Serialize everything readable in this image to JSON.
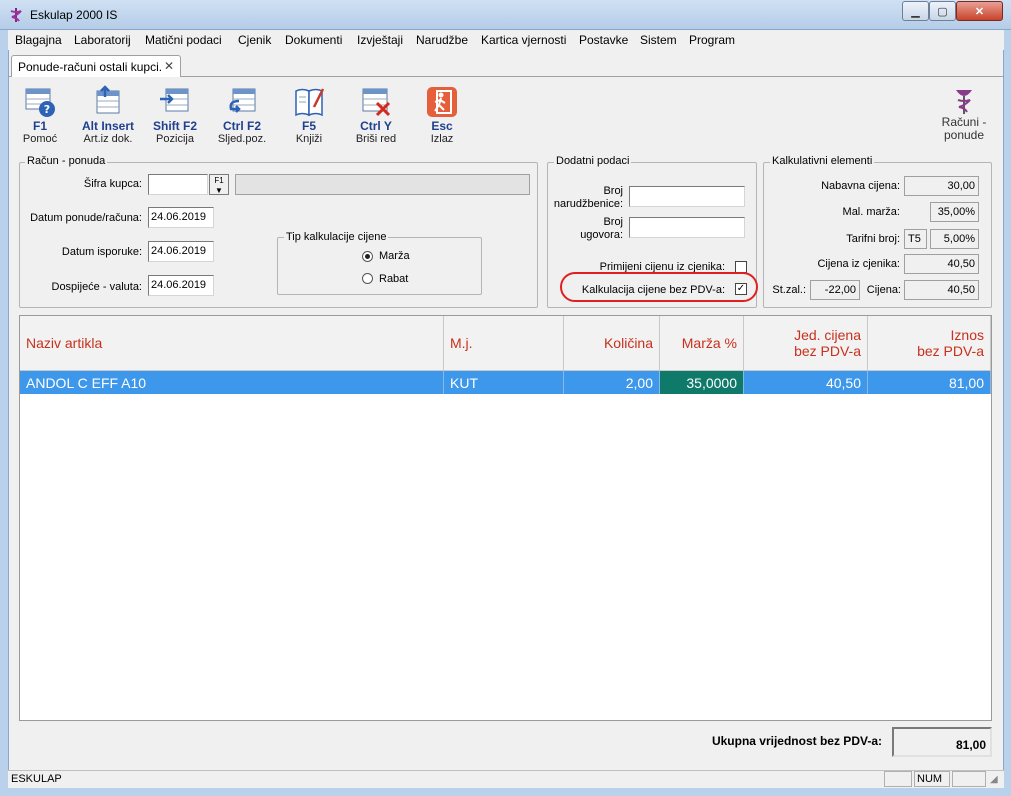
{
  "window": {
    "title": "Eskulap 2000  IS"
  },
  "menu": [
    {
      "label": "Blagajna"
    },
    {
      "label": "Laboratorij"
    },
    {
      "label": "Matični podaci"
    },
    {
      "label": "Cjenik"
    },
    {
      "label": "Dokumenti"
    },
    {
      "label": "Izvještaji"
    },
    {
      "label": "Narudžbe"
    },
    {
      "label": "Kartica vjernosti"
    },
    {
      "label": "Postavke"
    },
    {
      "label": "Sistem"
    },
    {
      "label": "Program"
    }
  ],
  "tab": {
    "label": "Ponude-računi ostali kupci.",
    "close": "✕"
  },
  "toolbar": [
    {
      "key": "F1",
      "label": "Pomoć",
      "icon": "help-icon"
    },
    {
      "key": "Alt Insert",
      "label": "Art.iz dok.",
      "icon": "import-articles-icon"
    },
    {
      "key": "Shift F2",
      "label": "Pozicija",
      "icon": "position-icon"
    },
    {
      "key": "Ctrl F2",
      "label": "Sljed.poz.",
      "icon": "next-position-icon"
    },
    {
      "key": "F5",
      "label": "Knjiži",
      "icon": "post-icon"
    },
    {
      "key": "Ctrl Y",
      "label": "Briši red",
      "icon": "delete-row-icon"
    },
    {
      "key": "Esc",
      "label": "Izlaz",
      "icon": "exit-icon"
    }
  ],
  "module": {
    "line1": "Računi -",
    "line2": "ponude"
  },
  "racun": {
    "title": "Račun - ponuda",
    "sifra_kupca_label": "Šifra kupca:",
    "sifra_kupca_value": "",
    "lookup_button": "F1",
    "kupac_name": "",
    "datum_ponude_label": "Datum ponude/računa:",
    "datum_ponude": "24.06.2019",
    "datum_isporuke_label": "Datum isporuke:",
    "datum_isporuke": "24.06.2019",
    "dospijece_label": "Dospijeće - valuta:",
    "dospijece": "24.06.2019",
    "tip_title": "Tip kalkulacije cijene",
    "tip_marza": "Marža",
    "tip_rabat": "Rabat",
    "tip_selected": "Marža"
  },
  "dodatni": {
    "title": "Dodatni podaci",
    "broj_narudzbenice_label1": "Broj",
    "broj_narudzbenice_label2": "narudžbenice:",
    "broj_narudzbenice": "",
    "broj_ugovora_label1": "Broj",
    "broj_ugovora_label2": "ugovora:",
    "broj_ugovora": "",
    "primijeni_label": "Primijeni cijenu iz cjenika:",
    "primijeni_checked": false,
    "kalkulacija_label": "Kalkulacija cijene bez PDV-a:",
    "kalkulacija_checked": true,
    "highlight_color": "#e02020"
  },
  "kalk": {
    "title": "Kalkulativni elementi",
    "nabavna_label": "Nabavna cijena:",
    "nabavna": "30,00",
    "marza_label": "Mal. marža:",
    "marza": "35,00%",
    "tarifni_label": "Tarifni broj:",
    "tarifni_code": "T5",
    "tarifni": "5,00%",
    "cjenik_label": "Cijena iz cjenika:",
    "cjenik": "40,50",
    "stzal_label": "St.zal.:",
    "stzal": "-22,00",
    "cijena_label": "Cijena:",
    "cijena": "40,50"
  },
  "grid": {
    "columns": [
      {
        "label": "Naziv artikla"
      },
      {
        "label": "M.j."
      },
      {
        "label": "Količina"
      },
      {
        "label": "Marža %"
      },
      {
        "label1": "Jed. cijena",
        "label2": "bez PDV-a"
      },
      {
        "label1": "Iznos",
        "label2": "bez PDV-a"
      }
    ],
    "rows": [
      {
        "naziv": "ANDOL C EFF A10",
        "mj": "KUT",
        "kolicina": "2,00",
        "marza": "35,0000",
        "jed_cijena": "40,50",
        "iznos": "81,00"
      }
    ],
    "header_color": "#c8301c",
    "selected_color": "#3d97ea",
    "edit_cell_color": "#0f7a6a"
  },
  "total": {
    "label": "Ukupna vrijednost bez PDV-a:",
    "value": "81,00"
  },
  "status": {
    "app": "ESKULAP",
    "num": "NUM"
  }
}
